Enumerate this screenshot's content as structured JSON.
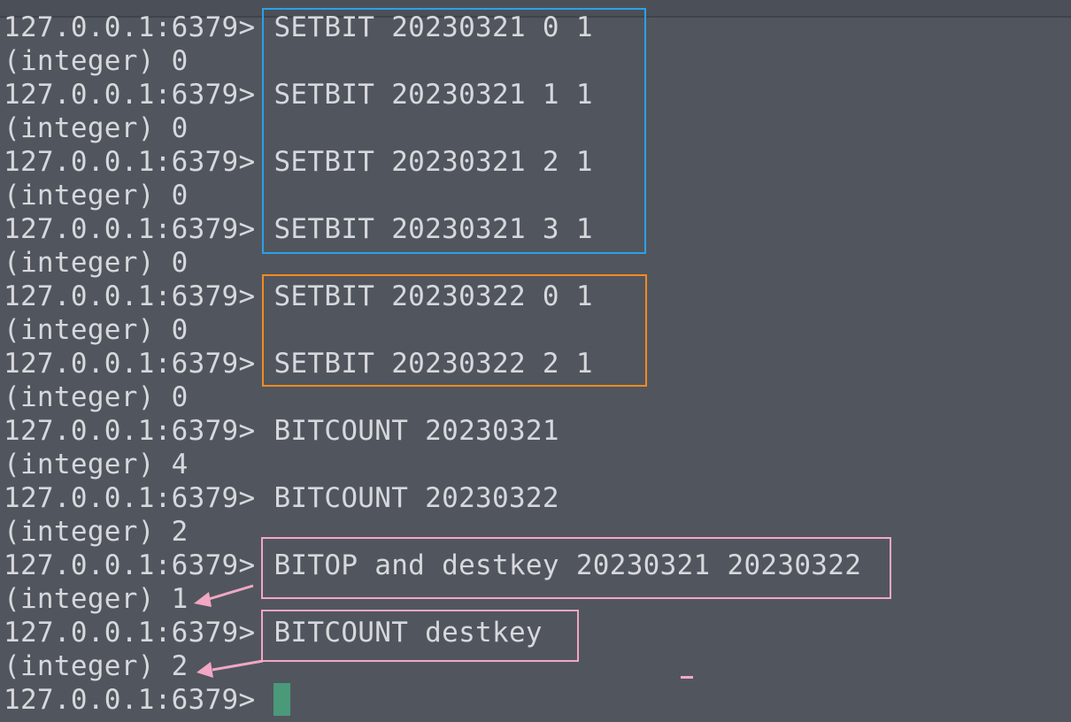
{
  "terminal": {
    "prompt": "127.0.0.1:6379>",
    "lines": [
      {
        "type": "command",
        "text": "SETBIT 20230321 0 1"
      },
      {
        "type": "output",
        "text": "(integer) 0"
      },
      {
        "type": "command",
        "text": "SETBIT 20230321 1 1"
      },
      {
        "type": "output",
        "text": "(integer) 0"
      },
      {
        "type": "command",
        "text": "SETBIT 20230321 2 1"
      },
      {
        "type": "output",
        "text": "(integer) 0"
      },
      {
        "type": "command",
        "text": "SETBIT 20230321 3 1"
      },
      {
        "type": "output",
        "text": "(integer) 0"
      },
      {
        "type": "command",
        "text": "SETBIT 20230322 0 1"
      },
      {
        "type": "output",
        "text": "(integer) 0"
      },
      {
        "type": "command",
        "text": "SETBIT 20230322 2 1"
      },
      {
        "type": "output",
        "text": "(integer) 0"
      },
      {
        "type": "command",
        "text": "BITCOUNT 20230321"
      },
      {
        "type": "output",
        "text": "(integer) 4"
      },
      {
        "type": "command",
        "text": "BITCOUNT 20230322"
      },
      {
        "type": "output",
        "text": "(integer) 2"
      },
      {
        "type": "command",
        "text": "BITOP and destkey 20230321 20230322"
      },
      {
        "type": "output",
        "text": "(integer) 1"
      },
      {
        "type": "command",
        "text": "BITCOUNT destkey"
      },
      {
        "type": "output",
        "text": "(integer) 2"
      },
      {
        "type": "command",
        "text": ""
      }
    ]
  },
  "annotation_colors": {
    "blue": "#2ca0e8",
    "orange": "#f58a1f",
    "pink": "#f2a7c4"
  },
  "cursor_color": "#4a9a7a"
}
